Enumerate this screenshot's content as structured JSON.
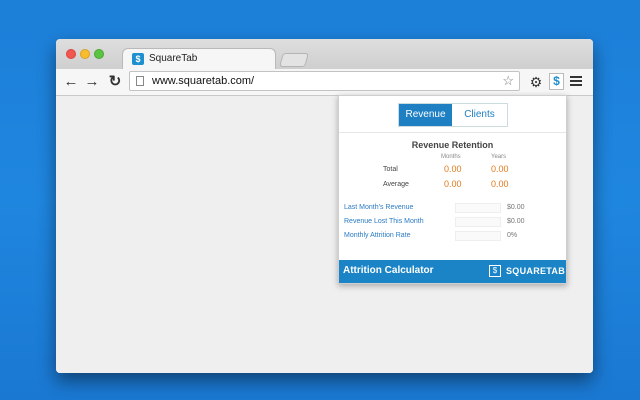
{
  "browser": {
    "tab_title": "SquareTab",
    "url": "www.squaretab.com/"
  },
  "popup": {
    "tabs": [
      "Revenue",
      "Clients"
    ],
    "active_tab": "Revenue",
    "section_title": "Revenue Retention",
    "col_headers": [
      "Months",
      "Years"
    ],
    "rows": [
      {
        "label": "Total",
        "months": "0.00",
        "years": "0.00"
      },
      {
        "label": "Average",
        "months": "0.00",
        "years": "0.00"
      }
    ],
    "inputs": [
      {
        "label": "Last Month's Revenue",
        "value": "$0.00"
      },
      {
        "label": "Revenue Lost This Month",
        "value": "$0.00"
      },
      {
        "label": "Monthly Attrition Rate",
        "value": "0%"
      }
    ],
    "footer_title": "Attrition Calculator",
    "brand": "SQUARETAB"
  },
  "colors": {
    "desktop": "#1f86df",
    "accent": "#1e7fc3",
    "value": "#e07a1c"
  }
}
